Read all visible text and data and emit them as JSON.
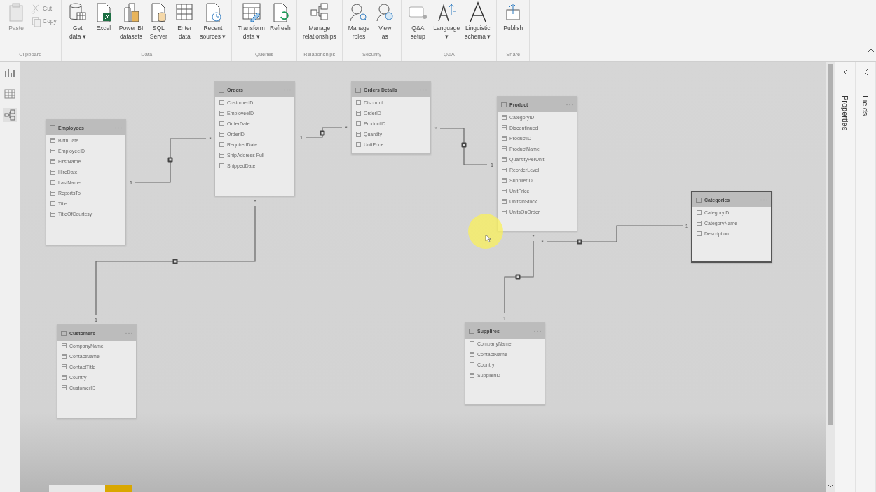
{
  "ribbon": {
    "groups": [
      {
        "label": "Clipboard",
        "buttons": [
          {
            "label": "Paste",
            "disabled": true,
            "kind": "large"
          },
          {
            "label": "Cut",
            "disabled": true,
            "kind": "small"
          },
          {
            "label": "Copy",
            "disabled": true,
            "kind": "small"
          }
        ]
      },
      {
        "label": "Data",
        "buttons": [
          {
            "label": "Get\ndata ▾",
            "disabled": false,
            "kind": "large"
          },
          {
            "label": "Excel",
            "disabled": false,
            "kind": "large"
          },
          {
            "label": "Power BI\ndatasets",
            "disabled": false,
            "kind": "large"
          },
          {
            "label": "SQL\nServer",
            "disabled": false,
            "kind": "large"
          },
          {
            "label": "Enter\ndata",
            "disabled": false,
            "kind": "large"
          },
          {
            "label": "Recent\nsources ▾",
            "disabled": false,
            "kind": "large"
          }
        ]
      },
      {
        "label": "Queries",
        "buttons": [
          {
            "label": "Transform\ndata ▾",
            "disabled": false,
            "kind": "large"
          },
          {
            "label": "Refresh",
            "disabled": false,
            "kind": "large"
          }
        ]
      },
      {
        "label": "Relationships",
        "buttons": [
          {
            "label": "Manage\nrelationships",
            "disabled": false,
            "kind": "large"
          }
        ]
      },
      {
        "label": "Security",
        "buttons": [
          {
            "label": "Manage\nroles",
            "disabled": false,
            "kind": "large"
          },
          {
            "label": "View\nas",
            "disabled": false,
            "kind": "large"
          }
        ]
      },
      {
        "label": "Q&A",
        "buttons": [
          {
            "label": "Q&A setup",
            "disabled": false,
            "kind": "large"
          },
          {
            "label": "Language\n▾",
            "disabled": false,
            "kind": "large"
          },
          {
            "label": "Linguistic\nschema ▾",
            "disabled": false,
            "kind": "large"
          }
        ]
      },
      {
        "label": "Share",
        "buttons": [
          {
            "label": "Publish",
            "disabled": false,
            "kind": "large"
          }
        ]
      }
    ]
  },
  "views": [
    {
      "selected": false
    },
    {
      "selected": false
    },
    {
      "selected": true
    }
  ],
  "tables": [
    {
      "name": "Employees",
      "selected": false,
      "fields": [
        "BirthDate",
        "EmployeeID",
        "FirstName",
        "HireDate",
        "LastName",
        "ReportsTo",
        "Title",
        "TitleOfCourtesy"
      ]
    },
    {
      "name": "Orders",
      "selected": false,
      "fields": [
        "CustomerID",
        "EmployeeID",
        "OrderDate",
        "OrderID",
        "RequiredDate",
        "ShipAddress Full",
        "ShippedDate"
      ]
    },
    {
      "name": "Orders Details",
      "selected": false,
      "fields": [
        "Discount",
        "OrderID",
        "ProductID",
        "Quantity",
        "UnitPrice"
      ]
    },
    {
      "name": "Product",
      "selected": false,
      "fields": [
        "CategoryID",
        "Discontinued",
        "ProductID",
        "ProductName",
        "QuantityPerUnit",
        "ReorderLevel",
        "SupplierID",
        "UnitPrice",
        "UnitsInStock",
        "UnitsOnOrder"
      ]
    },
    {
      "name": "Categories",
      "selected": true,
      "fields": [
        "CategoryID",
        "CategoryName",
        "Description"
      ]
    },
    {
      "name": "Customers",
      "selected": false,
      "fields": [
        "CompanyName",
        "ContactName",
        "ContactTitle",
        "Country",
        "CustomerID"
      ]
    },
    {
      "name": "Supplires",
      "selected": false,
      "fields": [
        "CompanyName",
        "ContactName",
        "Country",
        "SupplierID"
      ]
    }
  ],
  "relationships": [
    {
      "from_label": "1",
      "to_label": "*"
    },
    {
      "from_label": "1",
      "to_label": "*"
    },
    {
      "from_label": "*",
      "to_label": "1"
    },
    {
      "from_label": "*",
      "to_label": "1"
    },
    {
      "from_label": "*",
      "to_label": "1"
    },
    {
      "from_label": "*",
      "to_label": "1"
    }
  ],
  "panes": [
    {
      "label": "Properties"
    },
    {
      "label": "Fields"
    }
  ],
  "pages": [
    {
      "selected": false
    },
    {
      "selected": true
    }
  ]
}
